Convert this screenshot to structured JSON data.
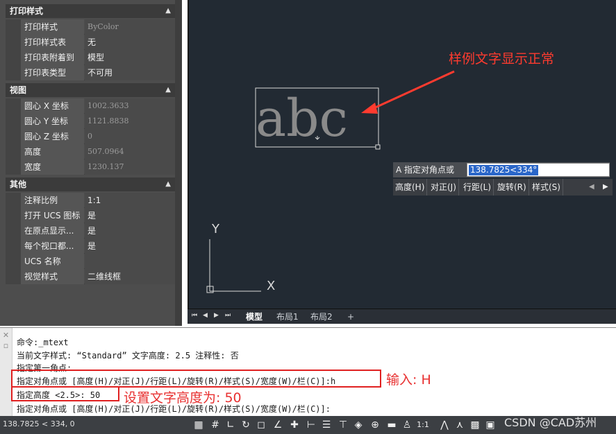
{
  "properties": {
    "sections": [
      {
        "title": "打印样式",
        "rows": [
          {
            "name": "打印样式",
            "value": "ByColor",
            "dim": true
          },
          {
            "name": "打印样式表",
            "value": "无",
            "dim": false
          },
          {
            "name": "打印表附着到",
            "value": "模型",
            "dim": false
          },
          {
            "name": "打印表类型",
            "value": "不可用",
            "dim": false
          }
        ]
      },
      {
        "title": "视图",
        "rows": [
          {
            "name": "圆心 X 坐标",
            "value": "1002.3633",
            "dim": true
          },
          {
            "name": "圆心 Y 坐标",
            "value": "1121.8838",
            "dim": true
          },
          {
            "name": "圆心 Z 坐标",
            "value": "0",
            "dim": true
          },
          {
            "name": "高度",
            "value": "507.0964",
            "dim": true
          },
          {
            "name": "宽度",
            "value": "1230.137",
            "dim": true
          }
        ]
      },
      {
        "title": "其他",
        "rows": [
          {
            "name": "注释比例",
            "value": "1:1",
            "dim": false
          },
          {
            "name": "打开 UCS 图标",
            "value": "是",
            "dim": false
          },
          {
            "name": "在原点显示...",
            "value": "是",
            "dim": false
          },
          {
            "name": "每个视口都...",
            "value": "是",
            "dim": false
          },
          {
            "name": "UCS 名称",
            "value": "",
            "dim": false
          },
          {
            "name": "视觉样式",
            "value": "二维线框",
            "dim": false
          }
        ]
      }
    ]
  },
  "canvas": {
    "sample_text": "abc",
    "annotation": "样例文字显示正常",
    "ucs_y": "Y",
    "ucs_x": "X"
  },
  "dynamic_prompt": {
    "label": "A 指定对角点或",
    "input_value": "138.7825<334°",
    "options": [
      "高度(H)",
      "对正(J)",
      "行距(L)",
      "旋转(R)",
      "样式(S)"
    ]
  },
  "layout_tabs": [
    "模型",
    "布局1",
    "布局2",
    "+"
  ],
  "command_lines": [
    "命令:_mtext",
    "当前文字样式: “Standard” 文字高度: 2.5 注释性: 否",
    "指定第一角点:",
    "指定对角点或 [高度(H)/对正(J)/行距(L)/旋转(R)/样式(S)/宽度(W)/栏(C)]:h",
    "指定高度 <2.5>: 50",
    "指定对角点或 [高度(H)/对正(J)/行距(L)/旋转(R)/样式(S)/宽度(W)/栏(C)]:"
  ],
  "annotations": {
    "input_note": "输入: H",
    "height_note": "设置文字高度为: 50"
  },
  "status": {
    "coordinates": "138.7825 < 334, 0",
    "scale": "1:1",
    "watermark": "CSDN @CAD苏州"
  },
  "colors": {
    "accent_red": "#e02020",
    "canvas_bg": "#222a33",
    "selection_blue": "#2a66c9"
  }
}
